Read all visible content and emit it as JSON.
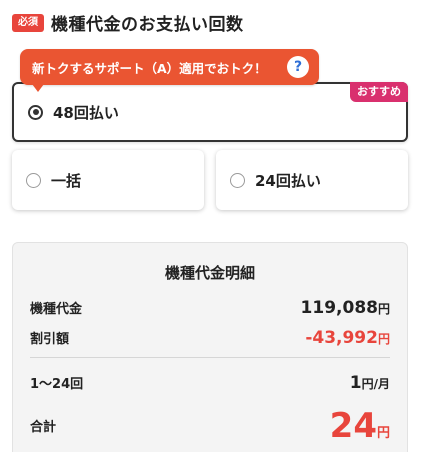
{
  "header": {
    "badge": "必須",
    "title": "機種代金のお支払い回数"
  },
  "promo": {
    "text": "新トクするサポート（A）適用でおトク！",
    "help_symbol": "?"
  },
  "options": {
    "opt48": {
      "label": "48回払い",
      "selected": true,
      "badge": "おすすめ"
    },
    "opt1": {
      "label": "一括",
      "selected": false
    },
    "opt24": {
      "label": "24回払い",
      "selected": false
    }
  },
  "detail": {
    "title": "機種代金明細",
    "device_price": {
      "label": "機種代金",
      "amount": "119,088",
      "unit": "円"
    },
    "discount": {
      "label": "割引額",
      "amount": "-43,992",
      "unit": "円"
    },
    "installment": {
      "label": "1〜24回",
      "amount": "1",
      "unit": "円/月"
    },
    "total": {
      "label": "合計",
      "amount": "24",
      "unit": "円"
    }
  },
  "colors": {
    "accent_red": "#e8453c",
    "promo_orange": "#ea5532",
    "recommend_pink": "#d9306e",
    "help_blue": "#2f6fd6"
  }
}
